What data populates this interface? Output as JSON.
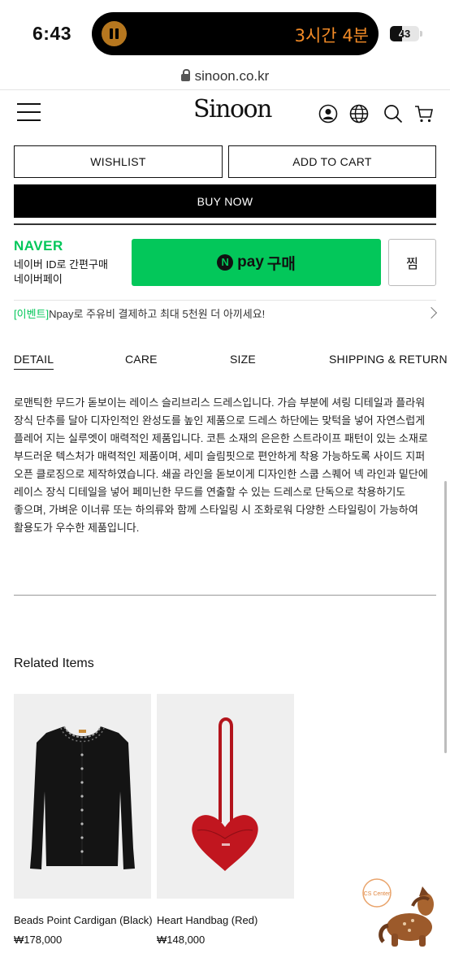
{
  "status": {
    "time": "6:43",
    "timer": "3시간 4분",
    "battery": "43"
  },
  "browser": {
    "url": "sinoon.co.kr"
  },
  "header": {
    "logo": "Sinoon"
  },
  "actions": {
    "wishlist": "WISHLIST",
    "add_to_cart": "ADD TO CART",
    "buy_now": "BUY NOW"
  },
  "naver": {
    "brand": "NAVER",
    "desc_line1": "네이버 ID로 간편구매",
    "desc_line2": "네이버페이",
    "pay_n": "N",
    "pay_word": "pay",
    "pay_buy": "구매",
    "jjim": "찜",
    "event_tag": "[이벤트]",
    "event_text": "Npay로 주유비 결제하고 최대 5천원 더 아끼세요!"
  },
  "tabs": [
    "DETAIL",
    "CARE",
    "SIZE",
    "SHIPPING & RETURN"
  ],
  "description": "로맨틱한 무드가 돋보이는 레이스 슬리브리스 드레스입니다. 가슴 부분에 셔링 디테일과 플라워 장식 단추를 달아 디자인적인 완성도를 높인 제품으로 드레스 하단에는 맞턱을 넣어 자연스럽게 플레어 지는 실루엣이 매력적인 제품입니다. 코튼 소재의 은은한 스트라이프 패턴이 있는 소재로 부드러운 텍스처가 매력적인 제품이며, 세미 슬림핏으로 편안하게 착용 가능하도록 사이드 지퍼 오픈 클로징으로 제작하였습니다. 쇄골 라인을 돋보이게 디자인한 스쿱 스퀘어 넥 라인과 밑단에 레이스 장식 디테일을 넣어 페미닌한 무드를 연출할 수 있는 드레스로 단독으로 착용하기도 좋으며, 가벼운 이너류 또는 하의류와 함께 스타일링 시 조화로워 다양한 스타일링이 가능하여 활용도가 우수한 제품입니다.",
  "related": {
    "title": "Related Items",
    "items": [
      {
        "name": "Beads Point Cardigan (Black)",
        "price": "₩178,000"
      },
      {
        "name": "Heart Handbag (Red)",
        "price": "₩148,000"
      }
    ]
  },
  "cs_label": "CS Center",
  "colors": {
    "naver_green": "#03c75a",
    "timer_orange": "#f28a26"
  }
}
